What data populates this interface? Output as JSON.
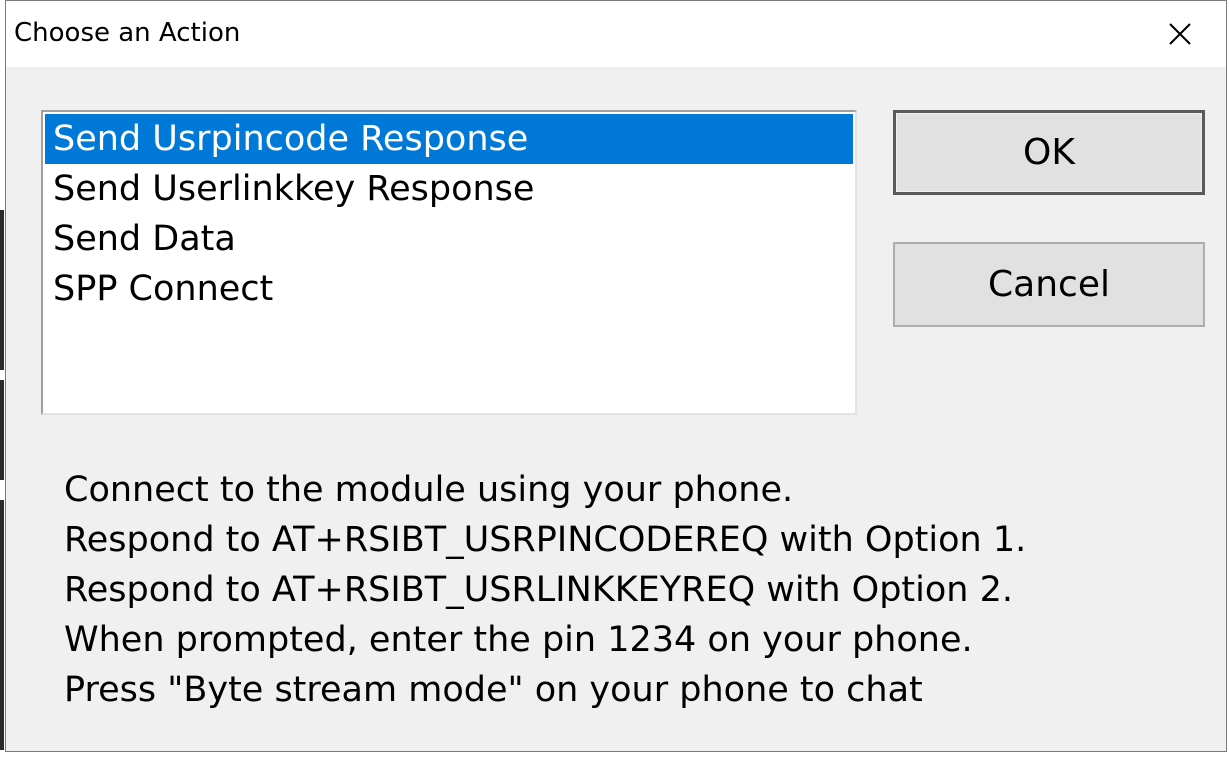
{
  "window": {
    "title": "Choose an Action",
    "close_icon": "close-x-icon"
  },
  "actions_list": {
    "items": [
      "Send Usrpincode Response",
      "Send Userlinkkey Response",
      "Send Data",
      "SPP Connect"
    ],
    "selected_index": 0
  },
  "buttons": {
    "ok_label": "OK",
    "cancel_label": "Cancel"
  },
  "instructions": [
    "Connect to the module using your phone.",
    "Respond to AT+RSIBT_USRPINCODEREQ with Option 1.",
    "Respond to AT+RSIBT_USRLINKKEYREQ with Option 2.",
    "When prompted, enter the pin 1234 on your phone.",
    "Press \"Byte stream mode\" on your phone to chat"
  ],
  "colors": {
    "selection": "#0078d7",
    "dialog_background": "#f0f0f0",
    "button_face": "#e1e1e1"
  }
}
